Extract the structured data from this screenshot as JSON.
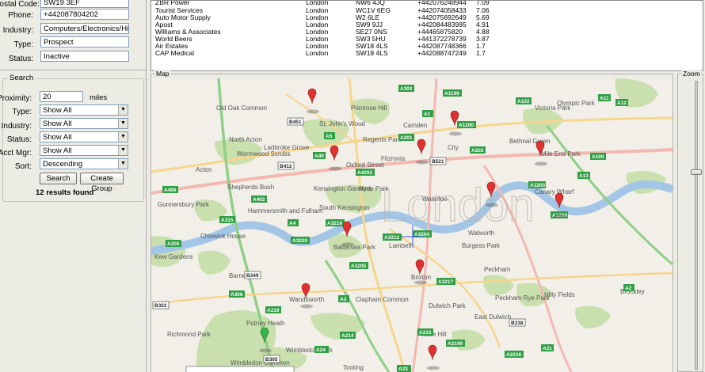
{
  "details": {
    "postal_code_label": "Postal Code:",
    "postal_code_value": "SW19 3EF",
    "phone_label": "Phone:",
    "phone_value": "+442087804202",
    "industry_label": "Industry:",
    "industry_value": "Computers/Electronics/High Tech",
    "type_label": "Type:",
    "type_value": "Prospect",
    "status_label": "Status:",
    "status_value": "Inactive"
  },
  "search": {
    "group_title": "Search",
    "proximity_label": "Proximity:",
    "proximity_value": "20",
    "proximity_unit": "miles",
    "type_label": "Type:",
    "type_value": "Show All",
    "industry_label": "Industry:",
    "industry_value": "Show All",
    "status_label": "Status:",
    "status_value": "Show All",
    "acct_mgr_label": "Acct Mgr:",
    "acct_mgr_value": "Show All",
    "sort_label": "Sort:",
    "sort_value": "Descending",
    "search_button": "Search",
    "create_group_button": "Create Group",
    "results_found": "12 results found"
  },
  "results": [
    {
      "name": "ZBR Power",
      "city": "London",
      "postcode": "NW6 4JQ",
      "phone": "+442076248944",
      "distance": "7.09"
    },
    {
      "name": "Tourist Services",
      "city": "London",
      "postcode": "WC1V 6EG",
      "phone": "+442074058433",
      "distance": "7.06"
    },
    {
      "name": "Auto Motor Supply",
      "city": "London",
      "postcode": "W2 6LE",
      "phone": "+442075692649",
      "distance": "5.69"
    },
    {
      "name": "Apost",
      "city": "London",
      "postcode": "SW9 9JJ",
      "phone": "+442084483995",
      "distance": "4.91"
    },
    {
      "name": "Williams & Associates",
      "city": "London",
      "postcode": "SE27 0NS",
      "phone": "+44465875820",
      "distance": "4.88"
    },
    {
      "name": "World Beers",
      "city": "London",
      "postcode": "SW3 5HU",
      "phone": "+441372278739",
      "distance": "3.87"
    },
    {
      "name": "Air Estates",
      "city": "London",
      "postcode": "SW18 4LS",
      "phone": "+442087748366",
      "distance": "1.7"
    },
    {
      "name": "CAP Medical",
      "city": "London",
      "postcode": "SW18 4LS",
      "phone": "+442088747249",
      "distance": "1.7"
    }
  ],
  "map": {
    "frame_title": "Map",
    "watermark": "London",
    "area_labels": [
      "Old Oak Common",
      "St. John's Wood",
      "North Acton",
      "Ladbroke Grove",
      "Fitzrovia",
      "Wormwood Scrubs",
      "Acton",
      "Shepherds Bush",
      "Kensington Gardens",
      "Hyde Park",
      "South Kensington",
      "Waterloo",
      "Hammersmith and Fulham",
      "Canary Wharf",
      "Gunnersbury Park",
      "Chiswick House",
      "Kew Gardens",
      "Battersea Park",
      "Walworth",
      "Peckham",
      "Barnes",
      "Putney Heath",
      "Wandsworth",
      "Clapham Common",
      "Brockley",
      "Richmond Park",
      "Wimbledon Park",
      "Wimbledon Common",
      "Tulse Hill",
      "East Dulwich",
      "Tooting",
      "Bethnal Green",
      "Olympic Park",
      "Primrose Hill",
      "Regents Park",
      "Camden",
      "City",
      "Mile End Park",
      "Victoria Park",
      "Burgess Park",
      "Brixton",
      "Dulwich Park",
      "Peckham Rye Park",
      "Hilly Fields",
      "Oxford Street",
      "Lambeth"
    ],
    "road_labels": [
      "A406",
      "A40",
      "A402",
      "A4",
      "A315",
      "A205",
      "A306",
      "A3",
      "A219",
      "A24",
      "A23",
      "A214",
      "A2",
      "A11",
      "A12",
      "A13",
      "A1203",
      "A1206",
      "A100",
      "A3205",
      "A302",
      "A202",
      "A201",
      "A1",
      "A5",
      "A4202",
      "A3212",
      "A3204",
      "A3220",
      "A3217",
      "B349",
      "B322",
      "B305",
      "B238",
      "B412",
      "B451",
      "B521",
      "A102",
      "A1199",
      "A1200",
      "A3216",
      "A215",
      "A2199",
      "A2216",
      "A21"
    ]
  },
  "zoom": {
    "label": "Zoom"
  }
}
